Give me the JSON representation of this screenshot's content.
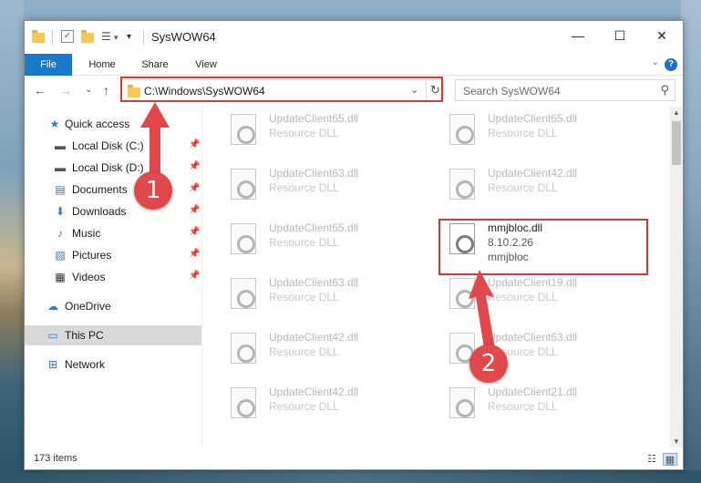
{
  "window": {
    "title": "SysWOW64",
    "minimize_glyph": "—",
    "maximize_glyph": "☐",
    "close_glyph": "✕"
  },
  "ribbon": {
    "tabs": [
      "File",
      "Home",
      "Share",
      "View"
    ],
    "help_glyph": "?",
    "collapse_glyph": "⌄"
  },
  "nav": {
    "back_glyph": "←",
    "forward_glyph": "→",
    "recent_glyph": "⌄",
    "up_glyph": "↑",
    "address": "C:\\Windows\\SysWOW64",
    "address_dropdown_glyph": "⌄",
    "refresh_glyph": "↻",
    "search_placeholder": "Search SysWOW64",
    "search_glyph": "⚲"
  },
  "sidebar": {
    "items": [
      {
        "label": "Quick access",
        "icon": "star-icon",
        "glyph": "★",
        "color": "#2f78d4",
        "pinned": false
      },
      {
        "label": "Local Disk (C:)",
        "icon": "drive-icon",
        "glyph": "▬",
        "color": "#555555",
        "pinned": true
      },
      {
        "label": "Local Disk (D:)",
        "icon": "drive-icon",
        "glyph": "▬",
        "color": "#555555",
        "pinned": true
      },
      {
        "label": "Documents",
        "icon": "documents-icon",
        "glyph": "▤",
        "color": "#4a6fa5",
        "pinned": true
      },
      {
        "label": "Downloads",
        "icon": "downloads-icon",
        "glyph": "⬇",
        "color": "#2f78d4",
        "pinned": true
      },
      {
        "label": "Music",
        "icon": "music-icon",
        "glyph": "♪",
        "color": "#2f78d4",
        "pinned": true
      },
      {
        "label": "Pictures",
        "icon": "pictures-icon",
        "glyph": "▧",
        "color": "#4a6fa5",
        "pinned": true
      },
      {
        "label": "Videos",
        "icon": "videos-icon",
        "glyph": "▦",
        "color": "#333333",
        "pinned": true
      },
      {
        "label": "OneDrive",
        "icon": "onedrive-icon",
        "glyph": "☁",
        "color": "#2f78d4",
        "pinned": false
      },
      {
        "label": "This PC",
        "icon": "this-pc-icon",
        "glyph": "▭",
        "color": "#2f78d4",
        "pinned": false
      },
      {
        "label": "Network",
        "icon": "network-icon",
        "glyph": "⊞",
        "color": "#2f78d4",
        "pinned": false
      }
    ],
    "pin_glyph": "📌"
  },
  "files": [
    {
      "name": "UpdateClient65.dll",
      "type": "Resource DLL"
    },
    {
      "name": "UpdateClient65.dll",
      "type": "Resource DLL"
    },
    {
      "name": "UpdateClient63.dll",
      "type": "Resource DLL"
    },
    {
      "name": "UpdateClient42.dll",
      "type": "Resource DLL"
    },
    {
      "name": "UpdateClient65.dll",
      "type": "Resource DLL"
    },
    {
      "name": "mmjbloc.dll",
      "version": "8.10.2.26",
      "description": "mmjbloc"
    },
    {
      "name": "UpdateClient63.dll",
      "type": "Resource DLL"
    },
    {
      "name": "UpdateClient19.dll",
      "type": "Resource DLL"
    },
    {
      "name": "UpdateClient42.dll",
      "type": "Resource DLL"
    },
    {
      "name": "UpdateClient63.dll",
      "type": "Resource DLL"
    },
    {
      "name": "UpdateClient42.dll",
      "type": "Resource DLL"
    },
    {
      "name": "UpdateClient21.dll",
      "type": "Resource DLL"
    }
  ],
  "status": {
    "item_count": "173 items",
    "details_view_glyph": "☷",
    "tiles_view_glyph": "▦"
  },
  "annotations": {
    "step1": "1",
    "step2": "2",
    "highlight_color": "#d9383a"
  }
}
